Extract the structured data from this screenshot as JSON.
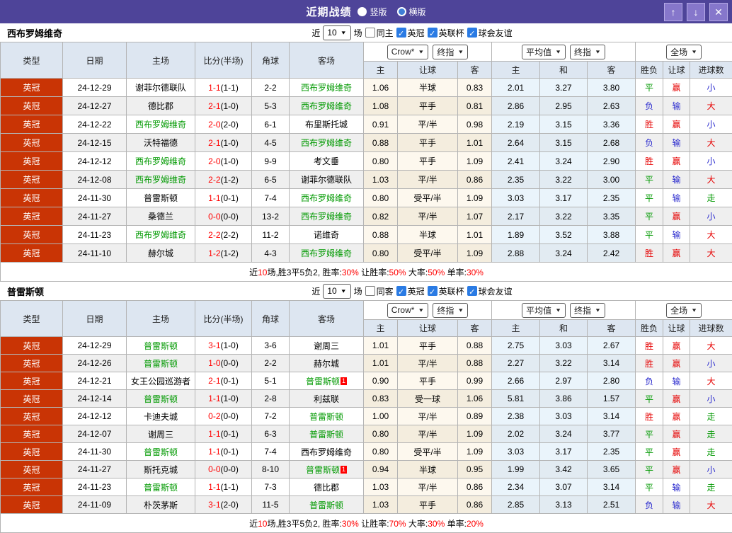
{
  "titlebar": {
    "title": "近期战绩",
    "radio_vertical": "竖版",
    "radio_horizontal": "横版",
    "buttons": {
      "up": "↑",
      "down": "↓",
      "close": "✕"
    }
  },
  "columns": {
    "type": "类型",
    "date": "日期",
    "home": "主场",
    "score": "比分(半场)",
    "corner": "角球",
    "away": "客场",
    "odds_home": "主",
    "odds_hand": "让球",
    "odds_away": "客",
    "avg_home": "主",
    "avg_draw": "和",
    "avg_away": "客",
    "res_spf": "胜负",
    "res_handicap": "让球",
    "res_goals": "进球数"
  },
  "dropdowns": {
    "company": "Crow*",
    "company_final": "终指",
    "average": "平均值",
    "average_final": "终指",
    "scope": "全场"
  },
  "sections": [
    {
      "team": "西布罗姆维奇",
      "filter": {
        "prefix": "近",
        "count": "10",
        "suffix": "场",
        "same": "同主",
        "leagues": [
          "英冠",
          "英联杯",
          "球会友谊"
        ]
      },
      "rows": [
        {
          "league": "英冠",
          "date": "24-12-29",
          "home": "谢菲尔德联队",
          "home_cls": "",
          "score": "1-1",
          "half": "(1-1)",
          "corner": "2-2",
          "away": "西布罗姆维奇",
          "away_cls": "t-g",
          "away_badge": "",
          "oh": "1.06",
          "hd": "半球",
          "oa": "0.83",
          "ah": "2.01",
          "ad": "3.27",
          "aa": "3.80",
          "spf": "平",
          "spf_cls": "t-g",
          "rq": "赢",
          "rq_cls": "t-r",
          "jq": "小",
          "jq_cls": "t-b"
        },
        {
          "league": "英冠",
          "date": "24-12-27",
          "home": "德比郡",
          "home_cls": "",
          "score": "2-1",
          "half": "(1-0)",
          "corner": "5-3",
          "away": "西布罗姆维奇",
          "away_cls": "t-g",
          "away_badge": "",
          "oh": "1.08",
          "hd": "平手",
          "oa": "0.81",
          "ah": "2.86",
          "ad": "2.95",
          "aa": "2.63",
          "spf": "负",
          "spf_cls": "t-b",
          "rq": "输",
          "rq_cls": "t-b",
          "jq": "大",
          "jq_cls": "t-r"
        },
        {
          "league": "英冠",
          "date": "24-12-22",
          "home": "西布罗姆维奇",
          "home_cls": "t-g",
          "score": "2-0",
          "half": "(2-0)",
          "corner": "6-1",
          "away": "布里斯托城",
          "away_cls": "",
          "away_badge": "",
          "oh": "0.91",
          "hd": "平/半",
          "oa": "0.98",
          "ah": "2.19",
          "ad": "3.15",
          "aa": "3.36",
          "spf": "胜",
          "spf_cls": "t-r",
          "rq": "赢",
          "rq_cls": "t-r",
          "jq": "小",
          "jq_cls": "t-b"
        },
        {
          "league": "英冠",
          "date": "24-12-15",
          "home": "沃特福德",
          "home_cls": "",
          "score": "2-1",
          "half": "(1-0)",
          "corner": "4-5",
          "away": "西布罗姆维奇",
          "away_cls": "t-g",
          "away_badge": "",
          "oh": "0.88",
          "hd": "平手",
          "oa": "1.01",
          "ah": "2.64",
          "ad": "3.15",
          "aa": "2.68",
          "spf": "负",
          "spf_cls": "t-b",
          "rq": "输",
          "rq_cls": "t-b",
          "jq": "大",
          "jq_cls": "t-r"
        },
        {
          "league": "英冠",
          "date": "24-12-12",
          "home": "西布罗姆维奇",
          "home_cls": "t-g",
          "score": "2-0",
          "half": "(1-0)",
          "corner": "9-9",
          "away": "考文垂",
          "away_cls": "",
          "away_badge": "",
          "oh": "0.80",
          "hd": "平手",
          "oa": "1.09",
          "ah": "2.41",
          "ad": "3.24",
          "aa": "2.90",
          "spf": "胜",
          "spf_cls": "t-r",
          "rq": "赢",
          "rq_cls": "t-r",
          "jq": "小",
          "jq_cls": "t-b"
        },
        {
          "league": "英冠",
          "date": "24-12-08",
          "home": "西布罗姆维奇",
          "home_cls": "t-g",
          "score": "2-2",
          "half": "(1-2)",
          "corner": "6-5",
          "away": "谢菲尔德联队",
          "away_cls": "",
          "away_badge": "",
          "oh": "1.03",
          "hd": "平/半",
          "oa": "0.86",
          "ah": "2.35",
          "ad": "3.22",
          "aa": "3.00",
          "spf": "平",
          "spf_cls": "t-g",
          "rq": "输",
          "rq_cls": "t-b",
          "jq": "大",
          "jq_cls": "t-r"
        },
        {
          "league": "英冠",
          "date": "24-11-30",
          "home": "普雷斯顿",
          "home_cls": "",
          "score": "1-1",
          "half": "(0-1)",
          "corner": "7-4",
          "away": "西布罗姆维奇",
          "away_cls": "t-g",
          "away_badge": "",
          "oh": "0.80",
          "hd": "受平/半",
          "oa": "1.09",
          "ah": "3.03",
          "ad": "3.17",
          "aa": "2.35",
          "spf": "平",
          "spf_cls": "t-g",
          "rq": "输",
          "rq_cls": "t-b",
          "jq": "走",
          "jq_cls": "t-g"
        },
        {
          "league": "英冠",
          "date": "24-11-27",
          "home": "桑德兰",
          "home_cls": "",
          "score": "0-0",
          "half": "(0-0)",
          "corner": "13-2",
          "away": "西布罗姆维奇",
          "away_cls": "t-g",
          "away_badge": "",
          "oh": "0.82",
          "hd": "平/半",
          "oa": "1.07",
          "ah": "2.17",
          "ad": "3.22",
          "aa": "3.35",
          "spf": "平",
          "spf_cls": "t-g",
          "rq": "赢",
          "rq_cls": "t-r",
          "jq": "小",
          "jq_cls": "t-b"
        },
        {
          "league": "英冠",
          "date": "24-11-23",
          "home": "西布罗姆维奇",
          "home_cls": "t-g",
          "score": "2-2",
          "half": "(2-2)",
          "corner": "11-2",
          "away": "诺维奇",
          "away_cls": "",
          "away_badge": "",
          "oh": "0.88",
          "hd": "半球",
          "oa": "1.01",
          "ah": "1.89",
          "ad": "3.52",
          "aa": "3.88",
          "spf": "平",
          "spf_cls": "t-g",
          "rq": "输",
          "rq_cls": "t-b",
          "jq": "大",
          "jq_cls": "t-r"
        },
        {
          "league": "英冠",
          "date": "24-11-10",
          "home": "赫尔城",
          "home_cls": "",
          "score": "1-2",
          "half": "(1-2)",
          "corner": "4-3",
          "away": "西布罗姆维奇",
          "away_cls": "t-g",
          "away_badge": "",
          "oh": "0.80",
          "hd": "受平/半",
          "oa": "1.09",
          "ah": "2.88",
          "ad": "3.24",
          "aa": "2.42",
          "spf": "胜",
          "spf_cls": "t-r",
          "rq": "赢",
          "rq_cls": "t-r",
          "jq": "大",
          "jq_cls": "t-r"
        }
      ],
      "summary": {
        "t1": "近",
        "v1": "10",
        "t2": "场,胜3平5负2, 胜率:",
        "v2": "30%",
        "t3": " 让胜率:",
        "v3": "50%",
        "t4": " 大率:",
        "v4": "50%",
        "t5": " 单率:",
        "v5": "30%"
      }
    },
    {
      "team": "普雷斯顿",
      "filter": {
        "prefix": "近",
        "count": "10",
        "suffix": "场",
        "same": "同客",
        "leagues": [
          "英冠",
          "英联杯",
          "球会友谊"
        ]
      },
      "rows": [
        {
          "league": "英冠",
          "date": "24-12-29",
          "home": "普雷斯顿",
          "home_cls": "t-g",
          "score": "3-1",
          "half": "(1-0)",
          "corner": "3-6",
          "away": "谢周三",
          "away_cls": "",
          "away_badge": "",
          "oh": "1.01",
          "hd": "平手",
          "oa": "0.88",
          "ah": "2.75",
          "ad": "3.03",
          "aa": "2.67",
          "spf": "胜",
          "spf_cls": "t-r",
          "rq": "赢",
          "rq_cls": "t-r",
          "jq": "大",
          "jq_cls": "t-r"
        },
        {
          "league": "英冠",
          "date": "24-12-26",
          "home": "普雷斯顿",
          "home_cls": "t-g",
          "score": "1-0",
          "half": "(0-0)",
          "corner": "2-2",
          "away": "赫尔城",
          "away_cls": "",
          "away_badge": "",
          "oh": "1.01",
          "hd": "平/半",
          "oa": "0.88",
          "ah": "2.27",
          "ad": "3.22",
          "aa": "3.14",
          "spf": "胜",
          "spf_cls": "t-r",
          "rq": "赢",
          "rq_cls": "t-r",
          "jq": "小",
          "jq_cls": "t-b"
        },
        {
          "league": "英冠",
          "date": "24-12-21",
          "home": "女王公园巡游者",
          "home_cls": "",
          "score": "2-1",
          "half": "(0-1)",
          "corner": "5-1",
          "away": "普雷斯顿",
          "away_cls": "t-g",
          "away_badge": "1",
          "oh": "0.90",
          "hd": "平手",
          "oa": "0.99",
          "ah": "2.66",
          "ad": "2.97",
          "aa": "2.80",
          "spf": "负",
          "spf_cls": "t-b",
          "rq": "输",
          "rq_cls": "t-b",
          "jq": "大",
          "jq_cls": "t-r"
        },
        {
          "league": "英冠",
          "date": "24-12-14",
          "home": "普雷斯顿",
          "home_cls": "t-g",
          "score": "1-1",
          "half": "(1-0)",
          "corner": "2-8",
          "away": "利兹联",
          "away_cls": "",
          "away_badge": "",
          "oh": "0.83",
          "hd": "受一球",
          "oa": "1.06",
          "ah": "5.81",
          "ad": "3.86",
          "aa": "1.57",
          "spf": "平",
          "spf_cls": "t-g",
          "rq": "赢",
          "rq_cls": "t-r",
          "jq": "小",
          "jq_cls": "t-b"
        },
        {
          "league": "英冠",
          "date": "24-12-12",
          "home": "卡迪夫城",
          "home_cls": "",
          "score": "0-2",
          "half": "(0-0)",
          "corner": "7-2",
          "away": "普雷斯顿",
          "away_cls": "t-g",
          "away_badge": "",
          "oh": "1.00",
          "hd": "平/半",
          "oa": "0.89",
          "ah": "2.38",
          "ad": "3.03",
          "aa": "3.14",
          "spf": "胜",
          "spf_cls": "t-r",
          "rq": "赢",
          "rq_cls": "t-r",
          "jq": "走",
          "jq_cls": "t-g"
        },
        {
          "league": "英冠",
          "date": "24-12-07",
          "home": "谢周三",
          "home_cls": "",
          "score": "1-1",
          "half": "(0-1)",
          "corner": "6-3",
          "away": "普雷斯顿",
          "away_cls": "t-g",
          "away_badge": "",
          "oh": "0.80",
          "hd": "平/半",
          "oa": "1.09",
          "ah": "2.02",
          "ad": "3.24",
          "aa": "3.77",
          "spf": "平",
          "spf_cls": "t-g",
          "rq": "赢",
          "rq_cls": "t-r",
          "jq": "走",
          "jq_cls": "t-g"
        },
        {
          "league": "英冠",
          "date": "24-11-30",
          "home": "普雷斯顿",
          "home_cls": "t-g",
          "score": "1-1",
          "half": "(0-1)",
          "corner": "7-4",
          "away": "西布罗姆维奇",
          "away_cls": "",
          "away_badge": "",
          "oh": "0.80",
          "hd": "受平/半",
          "oa": "1.09",
          "ah": "3.03",
          "ad": "3.17",
          "aa": "2.35",
          "spf": "平",
          "spf_cls": "t-g",
          "rq": "赢",
          "rq_cls": "t-r",
          "jq": "走",
          "jq_cls": "t-g"
        },
        {
          "league": "英冠",
          "date": "24-11-27",
          "home": "斯托克城",
          "home_cls": "",
          "score": "0-0",
          "half": "(0-0)",
          "corner": "8-10",
          "away": "普雷斯顿",
          "away_cls": "t-g",
          "away_badge": "1",
          "oh": "0.94",
          "hd": "半球",
          "oa": "0.95",
          "ah": "1.99",
          "ad": "3.42",
          "aa": "3.65",
          "spf": "平",
          "spf_cls": "t-g",
          "rq": "赢",
          "rq_cls": "t-r",
          "jq": "小",
          "jq_cls": "t-b"
        },
        {
          "league": "英冠",
          "date": "24-11-23",
          "home": "普雷斯顿",
          "home_cls": "t-g",
          "score": "1-1",
          "half": "(1-1)",
          "corner": "7-3",
          "away": "德比郡",
          "away_cls": "",
          "away_badge": "",
          "oh": "1.03",
          "hd": "平/半",
          "oa": "0.86",
          "ah": "2.34",
          "ad": "3.07",
          "aa": "3.14",
          "spf": "平",
          "spf_cls": "t-g",
          "rq": "输",
          "rq_cls": "t-b",
          "jq": "走",
          "jq_cls": "t-g"
        },
        {
          "league": "英冠",
          "date": "24-11-09",
          "home": "朴茨茅斯",
          "home_cls": "",
          "score": "3-1",
          "half": "(2-0)",
          "corner": "11-5",
          "away": "普雷斯顿",
          "away_cls": "t-g",
          "away_badge": "",
          "oh": "1.03",
          "hd": "平手",
          "oa": "0.86",
          "ah": "2.85",
          "ad": "3.13",
          "aa": "2.51",
          "spf": "负",
          "spf_cls": "t-b",
          "rq": "输",
          "rq_cls": "t-b",
          "jq": "大",
          "jq_cls": "t-r"
        }
      ],
      "summary": {
        "t1": "近",
        "v1": "10",
        "t2": "场,胜3平5负2, 胜率:",
        "v2": "30%",
        "t3": " 让胜率:",
        "v3": "70%",
        "t4": " 大率:",
        "v4": "30%",
        "t5": " 单率:",
        "v5": "20%"
      }
    }
  ]
}
